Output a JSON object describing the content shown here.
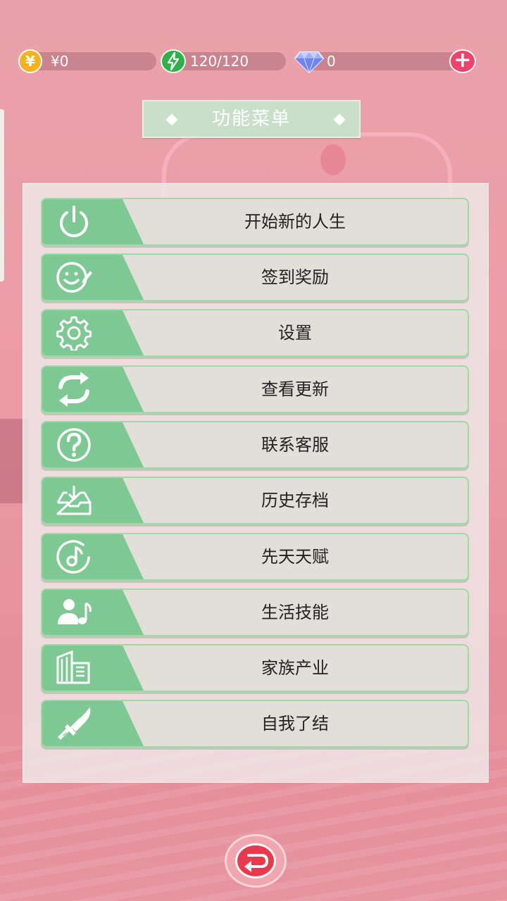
{
  "resources": {
    "currency": "¥0",
    "energy": "120/120",
    "diamonds": "0"
  },
  "title": "功能菜单",
  "menu": [
    {
      "label": "开始新的人生",
      "icon": "power-icon"
    },
    {
      "label": "签到奖励",
      "icon": "smile-pen-icon"
    },
    {
      "label": "设置",
      "icon": "gear-icon"
    },
    {
      "label": "查看更新",
      "icon": "refresh-icon"
    },
    {
      "label": "联系客服",
      "icon": "question-icon"
    },
    {
      "label": "历史存档",
      "icon": "inbox-download-icon"
    },
    {
      "label": "先天天赋",
      "icon": "music-disc-icon"
    },
    {
      "label": "生活技能",
      "icon": "person-music-icon"
    },
    {
      "label": "家族产业",
      "icon": "buildings-icon"
    },
    {
      "label": "自我了结",
      "icon": "knife-icon"
    }
  ],
  "colors": {
    "menu_icon_bg": "#7ec893",
    "menu_border": "#9fd9a8",
    "coin": "#f6b21a",
    "energy": "#2fb04a",
    "plus": "#f0436b",
    "back": "#e83a4d"
  }
}
